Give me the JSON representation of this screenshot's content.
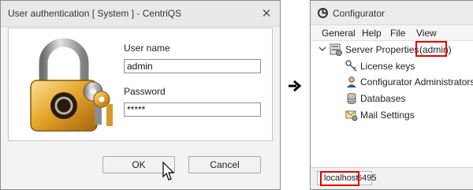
{
  "auth_dialog": {
    "title": "User authentication [ System ] - CentriQS",
    "close_glyph": "✕",
    "username_label": "User name",
    "username_value": "admin",
    "password_label": "Password",
    "password_value": "*****",
    "ok_label": "OK",
    "cancel_label": "Cancel",
    "accent_ok": "#fbe7a9"
  },
  "configurator": {
    "title": "Configurator",
    "menu": [
      {
        "label": "General"
      },
      {
        "label": "Help"
      },
      {
        "label": "File"
      },
      {
        "label": "View"
      }
    ],
    "tree": {
      "root_label": "Server Properties",
      "root_suffix": "(admin)",
      "children": [
        {
          "label": "License keys",
          "icon": "key-icon"
        },
        {
          "label": "Configurator Administrators",
          "icon": "user-icon"
        },
        {
          "label": "Databases",
          "icon": "database-icon"
        },
        {
          "label": "Mail Settings",
          "icon": "mail-settings-icon"
        }
      ]
    },
    "status": {
      "host": "localhost",
      "port": "6495"
    }
  },
  "highlight_color": "#e60000"
}
